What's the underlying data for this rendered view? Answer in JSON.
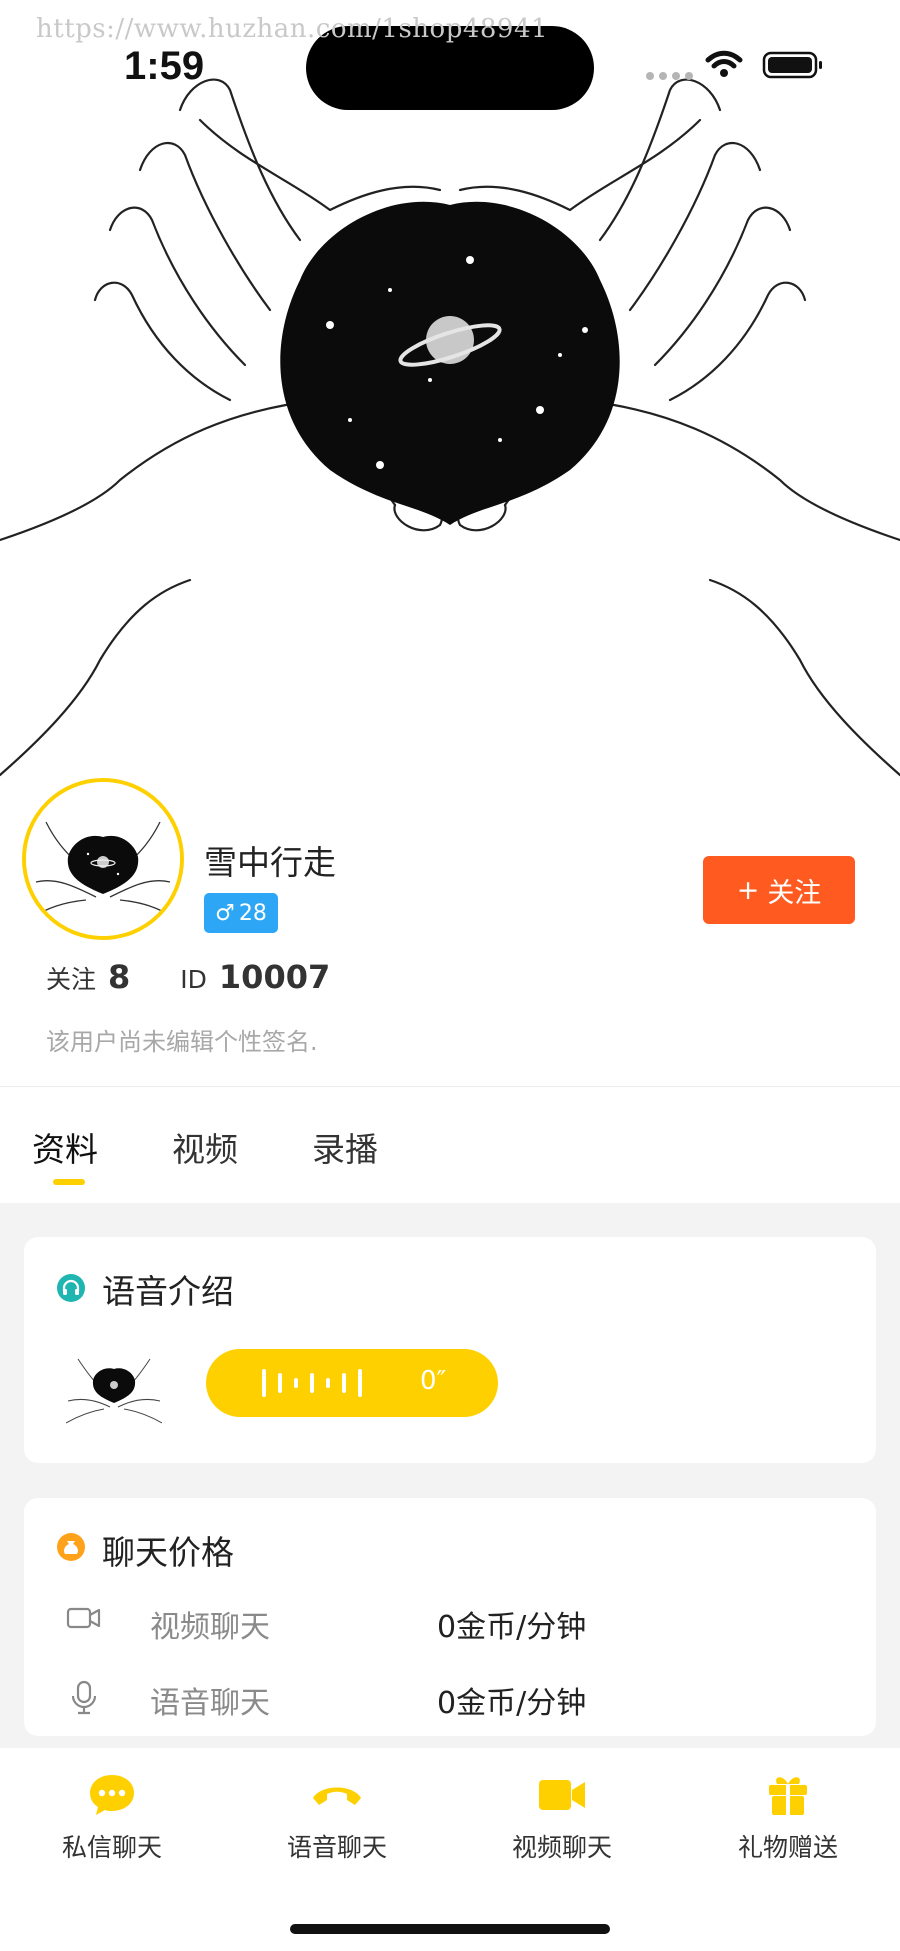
{
  "watermark": "https://www.huzhan.com/1shop48941",
  "status_bar": {
    "time": "1:59",
    "icons": [
      "signal-dots-icon",
      "wifi-icon",
      "battery-icon"
    ]
  },
  "cover_image": "hands-heart-planet-illustration",
  "profile": {
    "name": "雪中行走",
    "gender_symbol": "♂",
    "age": "28",
    "follow_button": {
      "icon": "+",
      "label": "关注"
    },
    "stats": [
      {
        "label": "关注",
        "value": "8"
      },
      {
        "label": "ID",
        "value": "10007"
      }
    ],
    "signature": "该用户尚未编辑个性签名."
  },
  "tabs": [
    {
      "label": "资料",
      "active": true
    },
    {
      "label": "视频",
      "active": false
    },
    {
      "label": "录播",
      "active": false
    }
  ],
  "voice_intro": {
    "title": "语音介绍",
    "duration": "0″"
  },
  "chat_price": {
    "title": "聊天价格",
    "rows": [
      {
        "icon": "video-camera-icon",
        "label": "视频聊天",
        "value": "0金币/分钟"
      },
      {
        "icon": "microphone-icon",
        "label": "语音聊天",
        "value": "0金币/分钟"
      }
    ]
  },
  "bottom_bar": [
    {
      "icon": "chat-bubble-icon",
      "label": "私信聊天"
    },
    {
      "icon": "phone-icon",
      "label": "语音聊天"
    },
    {
      "icon": "video-icon",
      "label": "视频聊天"
    },
    {
      "icon": "gift-icon",
      "label": "礼物赠送"
    }
  ],
  "colors": {
    "accent_yellow": "#FFD000",
    "follow_orange": "#FF5A1F",
    "gender_blue": "#2DA7F5",
    "headphone_teal": "#1FB5B0",
    "price_orange": "#FFA21A"
  }
}
